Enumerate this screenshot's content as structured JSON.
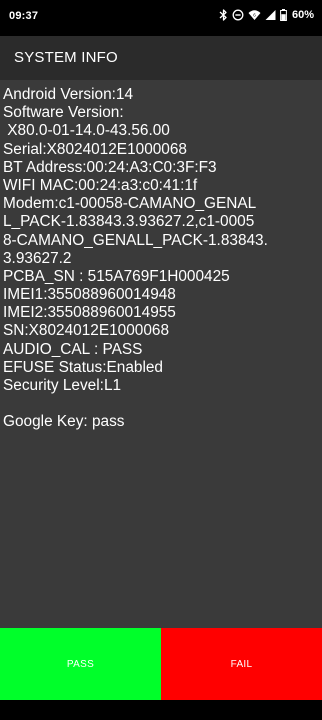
{
  "status_bar": {
    "time": "09:37",
    "icons": [
      "bluetooth-icon",
      "do-not-disturb-icon",
      "wifi-icon",
      "signal-icon",
      "battery-icon"
    ],
    "battery_text": "60%"
  },
  "app_bar": {
    "title": "SYSTEM INFO"
  },
  "info": {
    "lines": [
      "Android Version:14",
      "Software Version:",
      " X80.0-01-14.0-43.56.00",
      "Serial:X8024012E1000068",
      "BT Address:00:24:A3:C0:3F:F3",
      "WIFI MAC:00:24:a3:c0:41:1f",
      "Modem:c1-00058-CAMANO_GENAL",
      "L_PACK-1.83843.3.93627.2,c1-0005",
      "8-CAMANO_GENALL_PACK-1.83843.",
      "3.93627.2",
      "PCBA_SN : 515A769F1H000425",
      "IMEI1:355088960014948",
      "IMEI2:355088960014955",
      "SN:X8024012E1000068",
      "AUDIO_CAL : PASS",
      "EFUSE Status:Enabled",
      "Security Level:L1",
      "",
      "Google Key: pass"
    ]
  },
  "buttons": {
    "pass_label": "PASS",
    "fail_label": "FAIL"
  },
  "colors": {
    "pass": "#00ff2a",
    "fail": "#ff0000",
    "content_bg": "#3a3a3a",
    "app_bar_bg": "#2b2b2b"
  }
}
